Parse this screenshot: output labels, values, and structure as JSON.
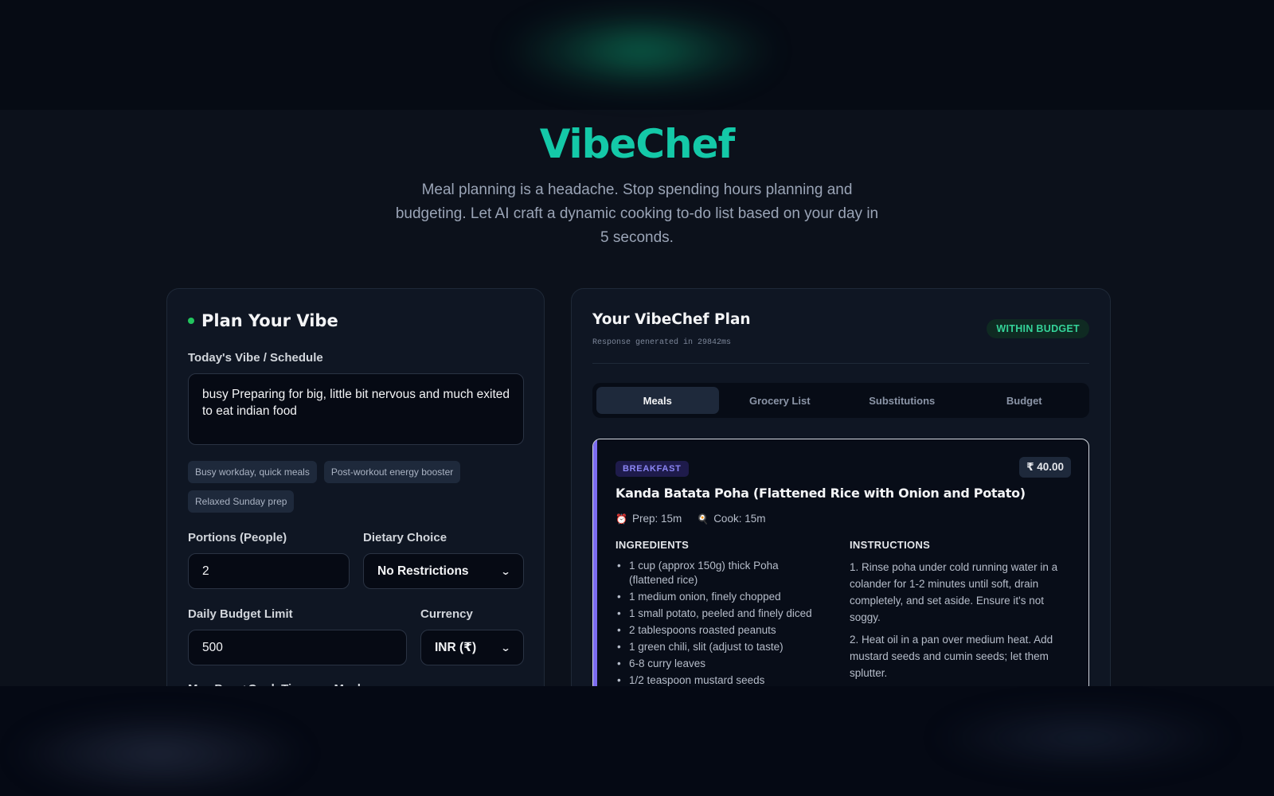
{
  "brand": "VibeChef",
  "tagline": "Meal planning is a headache. Stop spending hours planning and budgeting. Let AI craft a dynamic cooking to-do list based on your day in 5 seconds.",
  "planner": {
    "title": "Plan Your Vibe",
    "vibe_label": "Today's Vibe / Schedule",
    "vibe_value": "busy Preparing for big, little bit nervous and much exited to eat indian food",
    "chips": [
      "Busy workday, quick meals",
      "Post-workout energy booster",
      "Relaxed Sunday prep"
    ],
    "portions_label": "Portions (People)",
    "portions_value": "2",
    "diet_label": "Dietary Choice",
    "diet_value": "No Restrictions",
    "budget_label": "Daily Budget Limit",
    "budget_value": "500",
    "currency_label": "Currency",
    "currency_value": "INR (₹)",
    "max_time_label": "Max Prep+Cook Time per Meal"
  },
  "plan": {
    "title": "Your VibeChef Plan",
    "meta": "Response generated in 29842ms",
    "status": "WITHIN BUDGET",
    "tabs": [
      "Meals",
      "Grocery List",
      "Substitutions",
      "Budget"
    ],
    "active_tab": "Meals"
  },
  "meal": {
    "type": "BREAKFAST",
    "price": "₹ 40.00",
    "name": "Kanda Batata Poha (Flattened Rice with Onion and Potato)",
    "prep": "Prep: 15m",
    "cook": "Cook: 15m",
    "ingredients_label": "INGREDIENTS",
    "instructions_label": "INSTRUCTIONS",
    "ingredients": [
      "1 cup (approx 150g) thick Poha (flattened rice)",
      "1 medium onion, finely chopped",
      "1 small potato, peeled and finely diced",
      "2 tablespoons roasted peanuts",
      "1 green chili, slit (adjust to taste)",
      "6-8 curry leaves",
      "1/2 teaspoon mustard seeds"
    ],
    "instructions": [
      "1. Rinse poha under cold running water in a colander for 1-2 minutes until soft, drain completely, and set aside. Ensure it's not soggy.",
      "2. Heat oil in a pan over medium heat. Add mustard seeds and cumin seeds; let them splutter."
    ]
  },
  "colors": {
    "brand": "#14c9a8",
    "accent": "#7c6cf0",
    "success": "#34d399",
    "background": "#0c111b"
  },
  "icons": {
    "prep": "timer-icon",
    "cook": "pan-icon",
    "select": "chevron-down-icon"
  }
}
